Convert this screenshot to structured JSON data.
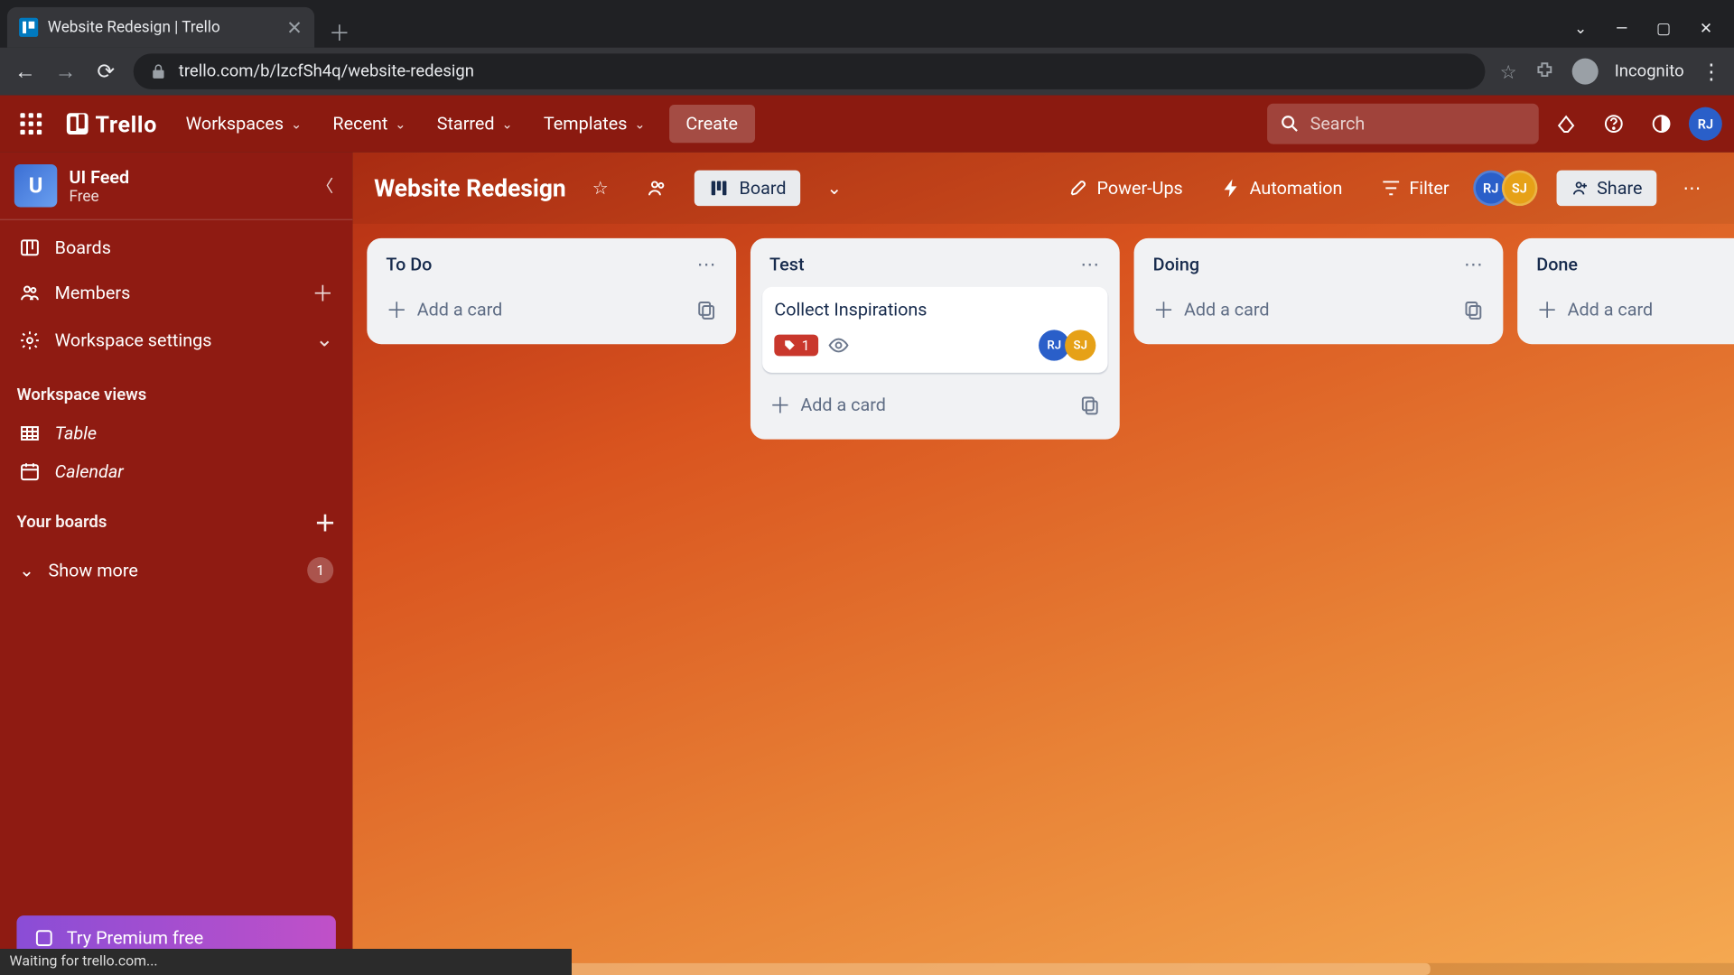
{
  "browser": {
    "tab_title": "Website Redesign | Trello",
    "url": "trello.com/b/lzcfSh4q/website-redesign",
    "incognito_label": "Incognito",
    "status_text": "Waiting for trello.com..."
  },
  "topnav": {
    "logo": "Trello",
    "menus": [
      "Workspaces",
      "Recent",
      "Starred",
      "Templates"
    ],
    "create": "Create",
    "search_placeholder": "Search",
    "avatar_initials": "RJ"
  },
  "sidebar": {
    "workspace_initial": "U",
    "workspace_name": "UI Feed",
    "workspace_plan": "Free",
    "items": [
      {
        "label": "Boards"
      },
      {
        "label": "Members"
      },
      {
        "label": "Workspace settings"
      }
    ],
    "views_heading": "Workspace views",
    "views": [
      "Table",
      "Calendar"
    ],
    "your_boards": "Your boards",
    "show_more": "Show more",
    "show_more_count": "1",
    "premium": "Try Premium free"
  },
  "board": {
    "title": "Website Redesign",
    "view_label": "Board",
    "powerups": "Power-Ups",
    "automation": "Automation",
    "filter": "Filter",
    "share": "Share",
    "members": [
      {
        "initials": "RJ",
        "class": "av-rj"
      },
      {
        "initials": "SJ",
        "class": "av-sj"
      }
    ]
  },
  "lists": [
    {
      "title": "To Do",
      "cards": [],
      "add_label": "Add a card"
    },
    {
      "title": "Test",
      "cards": [
        {
          "title": "Collect Inspirations",
          "badge_value": "1",
          "watching": true,
          "members": [
            {
              "initials": "RJ",
              "class": "av-rj"
            },
            {
              "initials": "SJ",
              "class": "av-sj"
            }
          ]
        }
      ],
      "add_label": "Add a card"
    },
    {
      "title": "Doing",
      "cards": [],
      "add_label": "Add a card"
    },
    {
      "title": "Done",
      "cards": [],
      "add_label": "Add a card"
    }
  ]
}
